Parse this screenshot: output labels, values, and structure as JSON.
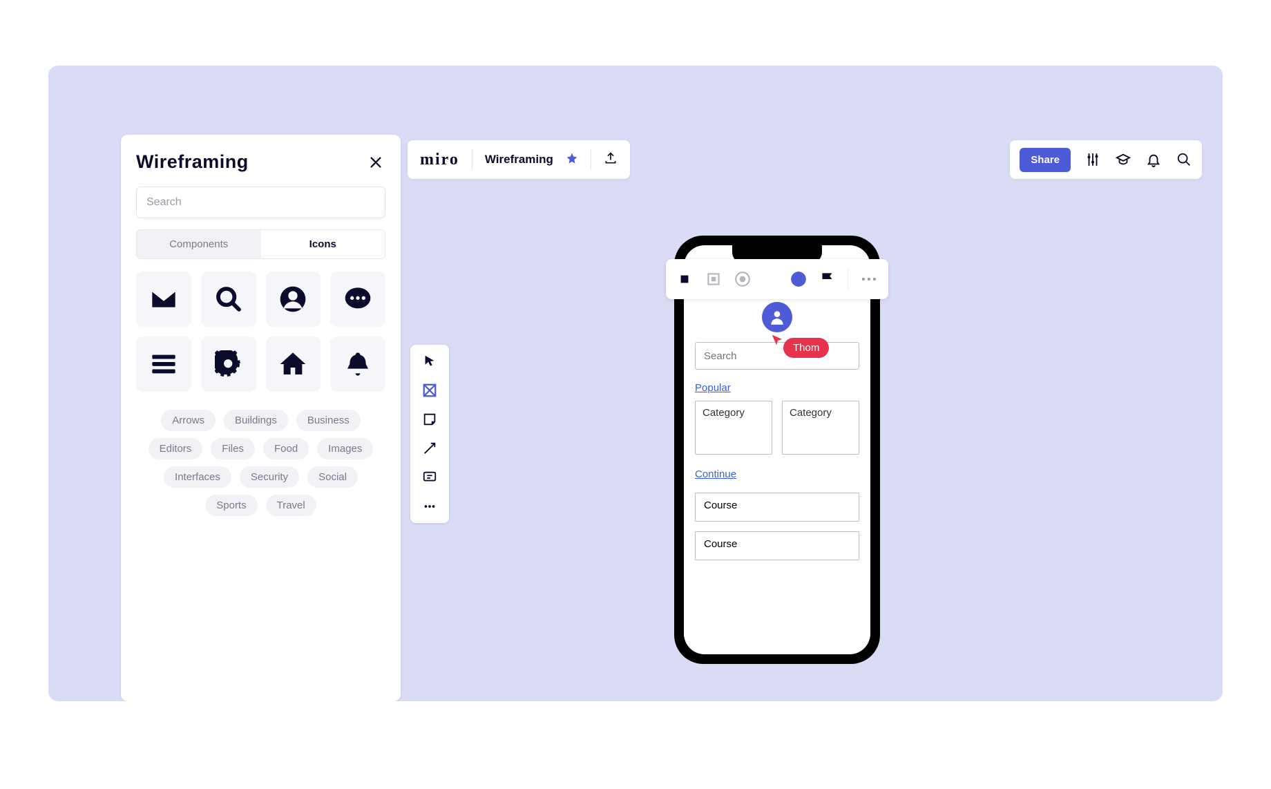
{
  "panel": {
    "title": "Wireframing",
    "search_placeholder": "Search",
    "tabs": {
      "components": "Components",
      "icons": "Icons"
    },
    "icons": [
      {
        "name": "envelope-icon"
      },
      {
        "name": "search-icon"
      },
      {
        "name": "user-circle-icon"
      },
      {
        "name": "comment-icon"
      },
      {
        "name": "menu-icon"
      },
      {
        "name": "gear-icon"
      },
      {
        "name": "home-icon"
      },
      {
        "name": "bell-icon"
      }
    ],
    "tags": [
      "Arrows",
      "Buildings",
      "Business",
      "Editors",
      "Files",
      "Food",
      "Images",
      "Interfaces",
      "Security",
      "Social",
      "Sports",
      "Travel"
    ]
  },
  "header": {
    "brand": "miro",
    "board_name": "Wireframing",
    "share_label": "Share"
  },
  "wireframe": {
    "search_placeholder": "Search",
    "popular_label": "Popular",
    "continue_label": "Continue",
    "category_label": "Category",
    "course_label": "Course"
  },
  "collaborator": {
    "name": "Thom"
  }
}
